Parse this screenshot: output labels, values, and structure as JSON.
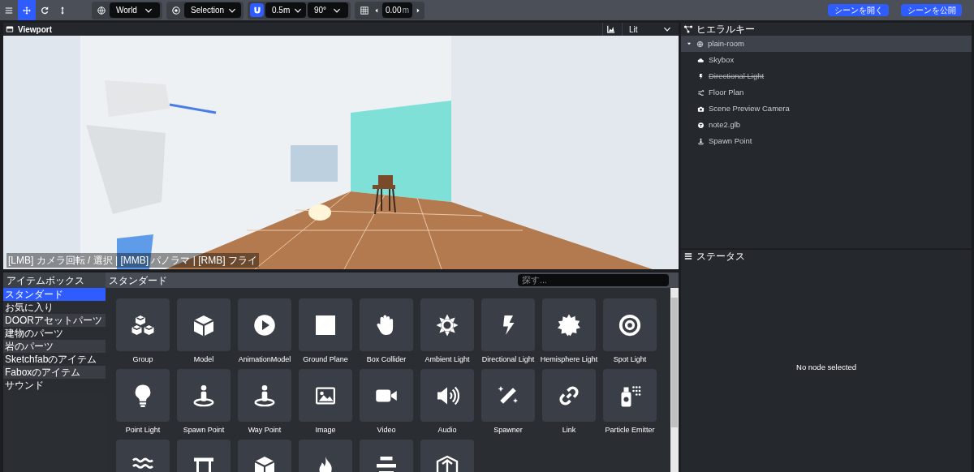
{
  "toolbar": {
    "modes": [
      {
        "selected": false
      },
      {
        "selected": true
      },
      {
        "selected": false
      },
      {
        "selected": false
      }
    ],
    "space": {
      "value": "World"
    },
    "pivot": {
      "value": "Selection"
    },
    "snap": {
      "on": true,
      "translate": "0.5m",
      "rotate": "90°"
    },
    "grid": {
      "value": "0.00",
      "unit": "m"
    },
    "buttons": [
      "シーンを開く",
      "シーンを公開"
    ]
  },
  "viewport": {
    "title": "Viewport",
    "shading": "Lit",
    "hint": "[LMB] カメラ回転 / 選択 | [MMB] パノラマ | [RMB] フライ"
  },
  "hierarchy": {
    "title": "ヒエラルキー",
    "items": [
      {
        "label": "plain-room",
        "kind": "scene",
        "expanded": true,
        "selected": true,
        "disabled": false,
        "children": [
          {
            "label": "Skybox",
            "kind": "skybox",
            "selected": false,
            "disabled": false
          },
          {
            "label": "Directional Light",
            "kind": "light",
            "selected": false,
            "disabled": true
          },
          {
            "label": "Floor Plan",
            "kind": "floorplan",
            "selected": false,
            "disabled": false
          },
          {
            "label": "Scene Preview Camera",
            "kind": "camera",
            "selected": false,
            "disabled": false
          },
          {
            "label": "note2.glb",
            "kind": "model",
            "selected": false,
            "disabled": false
          },
          {
            "label": "Spawn Point",
            "kind": "spawn",
            "selected": false,
            "disabled": false
          }
        ]
      }
    ]
  },
  "status": {
    "title": "ステータス",
    "message": "No node selected"
  },
  "itembox": {
    "title": "アイテムボックス",
    "categories": [
      {
        "label": "スタンダード",
        "selected": true
      },
      {
        "label": "お気に入り",
        "selected": false
      },
      {
        "label": "DOORアセットパーツ",
        "selected": false
      },
      {
        "label": "建物のパーツ",
        "selected": false
      },
      {
        "label": "岩のパーツ",
        "selected": false
      },
      {
        "label": "Sketchfabのアイテム",
        "selected": false
      },
      {
        "label": "Faboxのアイテム",
        "selected": false
      },
      {
        "label": "サウンド",
        "selected": false
      }
    ],
    "section": "スタンダード",
    "search": {
      "placeholder": "探す..."
    },
    "items": [
      {
        "label": "Group",
        "kind": "cubes"
      },
      {
        "label": "Model",
        "kind": "cube"
      },
      {
        "label": "AnimationModel",
        "kind": "play"
      },
      {
        "label": "Ground Plane",
        "kind": "square"
      },
      {
        "label": "Box Collider",
        "kind": "hand"
      },
      {
        "label": "Ambient Light",
        "kind": "sun"
      },
      {
        "label": "Directional Light",
        "kind": "bolt"
      },
      {
        "label": "Hemisphere Light",
        "kind": "burst"
      },
      {
        "label": "Spot Light",
        "kind": "bullseye"
      },
      {
        "label": "Point Light",
        "kind": "bulb"
      },
      {
        "label": "Spawn Point",
        "kind": "person"
      },
      {
        "label": "Way Point",
        "kind": "person"
      },
      {
        "label": "Image",
        "kind": "image"
      },
      {
        "label": "Video",
        "kind": "video"
      },
      {
        "label": "Audio",
        "kind": "speaker"
      },
      {
        "label": "Spawner",
        "kind": "wand"
      },
      {
        "label": "Link",
        "kind": "link"
      },
      {
        "label": "Particle Emitter",
        "kind": "spray"
      },
      {
        "kind": "water"
      },
      {
        "kind": "frame"
      },
      {
        "kind": "cube"
      },
      {
        "kind": "fire"
      },
      {
        "kind": "stack"
      },
      {
        "kind": "box3d"
      }
    ]
  }
}
